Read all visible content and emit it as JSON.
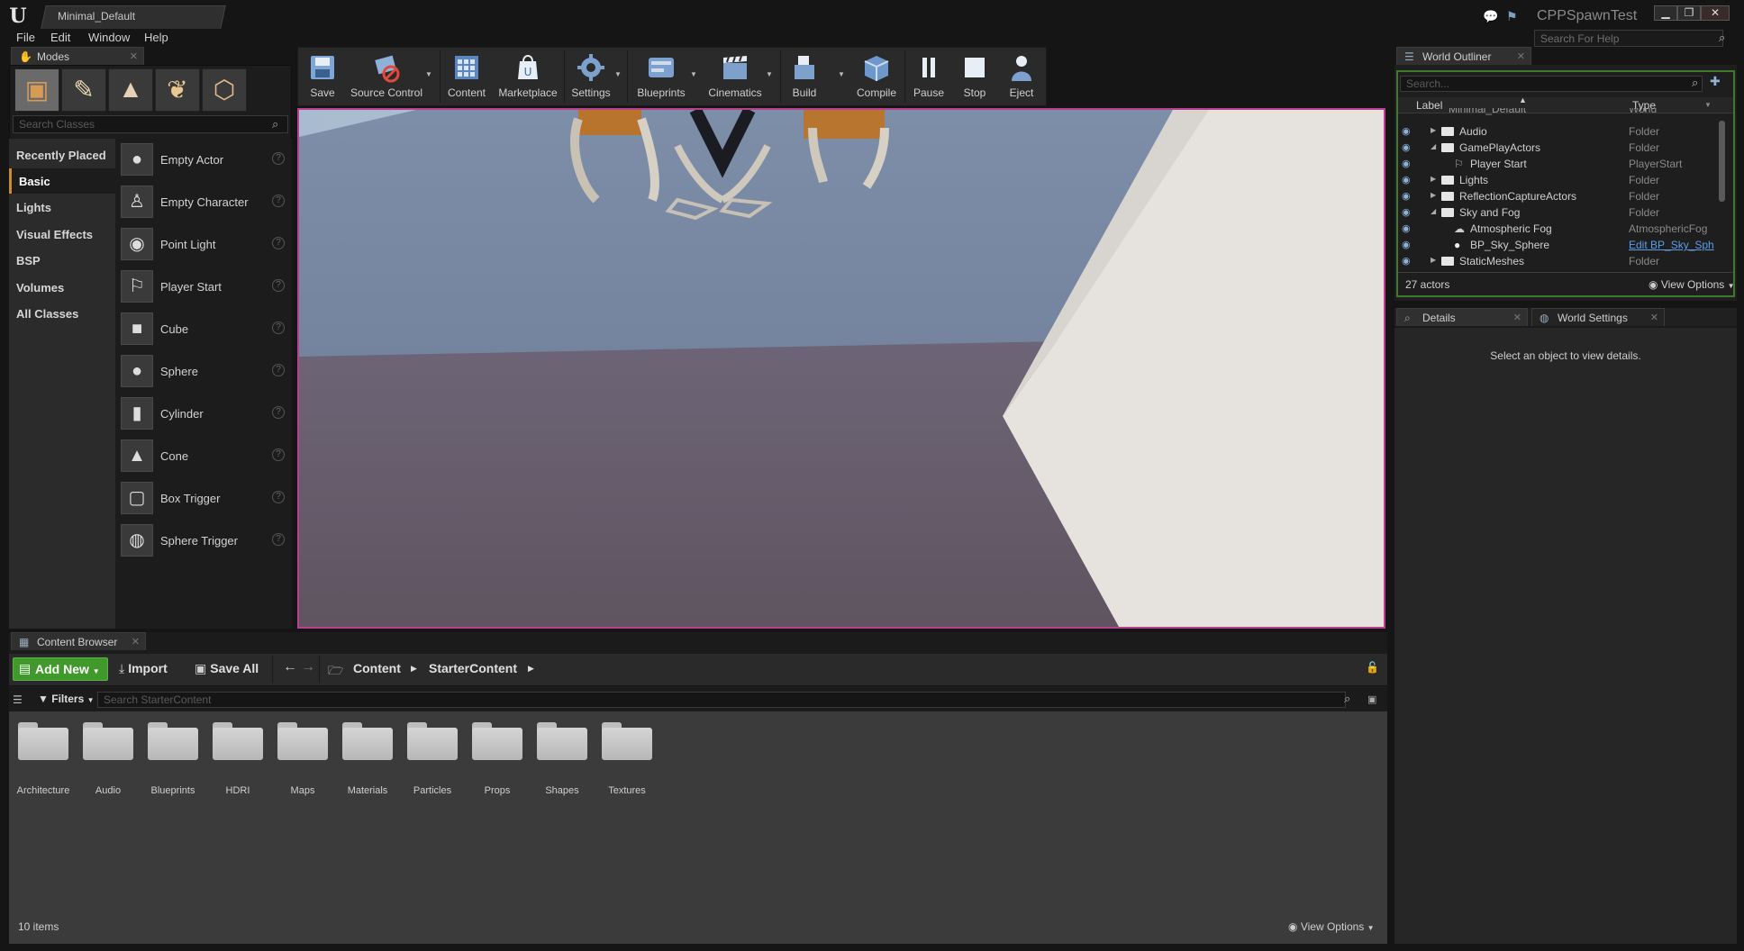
{
  "window": {
    "logo": "U",
    "document_tab": "Minimal_Default",
    "project_name": "CPPSpawnTest",
    "controls": [
      "▁",
      "❐",
      "✕"
    ],
    "help_search_placeholder": "Search For Help"
  },
  "menu": [
    "File",
    "Edit",
    "Window",
    "Help"
  ],
  "modes": {
    "tab_label": "Modes",
    "search_placeholder": "Search Classes",
    "categories": [
      "Recently Placed",
      "Basic",
      "Lights",
      "Visual Effects",
      "BSP",
      "Volumes",
      "All Classes"
    ],
    "active_category": "Basic",
    "classes": [
      {
        "name": "Empty Actor",
        "icon": "sphere-icon"
      },
      {
        "name": "Empty Character",
        "icon": "character-icon"
      },
      {
        "name": "Point Light",
        "icon": "lightbulb-icon"
      },
      {
        "name": "Player Start",
        "icon": "player-start-icon"
      },
      {
        "name": "Cube",
        "icon": "cube-icon"
      },
      {
        "name": "Sphere",
        "icon": "sphere-icon"
      },
      {
        "name": "Cylinder",
        "icon": "cylinder-icon"
      },
      {
        "name": "Cone",
        "icon": "cone-icon"
      },
      {
        "name": "Box Trigger",
        "icon": "box-trigger-icon"
      },
      {
        "name": "Sphere Trigger",
        "icon": "sphere-trigger-icon"
      }
    ],
    "help_glyph": "?"
  },
  "toolbar": [
    {
      "label": "Save",
      "icon": "save-icon"
    },
    {
      "label": "Source Control",
      "icon": "source-control-icon"
    },
    {
      "label": "Content",
      "icon": "content-icon"
    },
    {
      "label": "Marketplace",
      "icon": "marketplace-icon"
    },
    {
      "label": "Settings",
      "icon": "settings-icon"
    },
    {
      "label": "Blueprints",
      "icon": "blueprints-icon"
    },
    {
      "label": "Cinematics",
      "icon": "cinematics-icon"
    },
    {
      "label": "Build",
      "icon": "build-icon"
    },
    {
      "label": "Compile",
      "icon": "compile-icon"
    },
    {
      "label": "Pause",
      "icon": "pause-icon"
    },
    {
      "label": "Stop",
      "icon": "stop-icon"
    },
    {
      "label": "Eject",
      "icon": "eject-icon"
    }
  ],
  "outliner": {
    "tab_label": "World Outliner",
    "search_placeholder": "Search...",
    "col_label": "Label",
    "col_type": "Type",
    "rows": [
      {
        "label": "Minimal_Default",
        "type": "World",
        "indent": 0,
        "kind": "world"
      },
      {
        "label": "Audio",
        "type": "Folder",
        "indent": 1,
        "kind": "folder",
        "expanded": false
      },
      {
        "label": "GamePlayActors",
        "type": "Folder",
        "indent": 1,
        "kind": "folder",
        "expanded": true
      },
      {
        "label": "Player Start",
        "type": "PlayerStart",
        "indent": 2,
        "kind": "actor"
      },
      {
        "label": "Lights",
        "type": "Folder",
        "indent": 1,
        "kind": "folder",
        "expanded": false
      },
      {
        "label": "ReflectionCaptureActors",
        "type": "Folder",
        "indent": 1,
        "kind": "folder",
        "expanded": false
      },
      {
        "label": "Sky and Fog",
        "type": "Folder",
        "indent": 1,
        "kind": "folder",
        "expanded": true
      },
      {
        "label": "Atmospheric Fog",
        "type": "AtmosphericFog",
        "indent": 2,
        "kind": "actor"
      },
      {
        "label": "BP_Sky_Sphere",
        "type": "Edit BP_Sky_Sph",
        "indent": 2,
        "kind": "actor",
        "link": true
      },
      {
        "label": "StaticMeshes",
        "type": "Folder",
        "indent": 1,
        "kind": "folder",
        "expanded": false
      }
    ],
    "actor_count": "27 actors",
    "view_options": "View Options"
  },
  "details": {
    "tab_details": "Details",
    "tab_world_settings": "World Settings",
    "message": "Select an object to view details."
  },
  "content_browser": {
    "tab_label": "Content Browser",
    "add_new": "Add New",
    "import": "Import",
    "save_all": "Save All",
    "path": [
      "Content",
      "StarterContent"
    ],
    "filters": "Filters",
    "search_placeholder": "Search StarterContent",
    "folders": [
      "Architecture",
      "Audio",
      "Blueprints",
      "HDRI",
      "Maps",
      "Materials",
      "Particles",
      "Props",
      "Shapes",
      "Textures"
    ],
    "item_count": "10 items",
    "view_options": "View Options"
  },
  "colors": {
    "accent_green": "#3f9a2b",
    "viewport_border": "#b9408e",
    "active_category": "#d08a2c"
  }
}
